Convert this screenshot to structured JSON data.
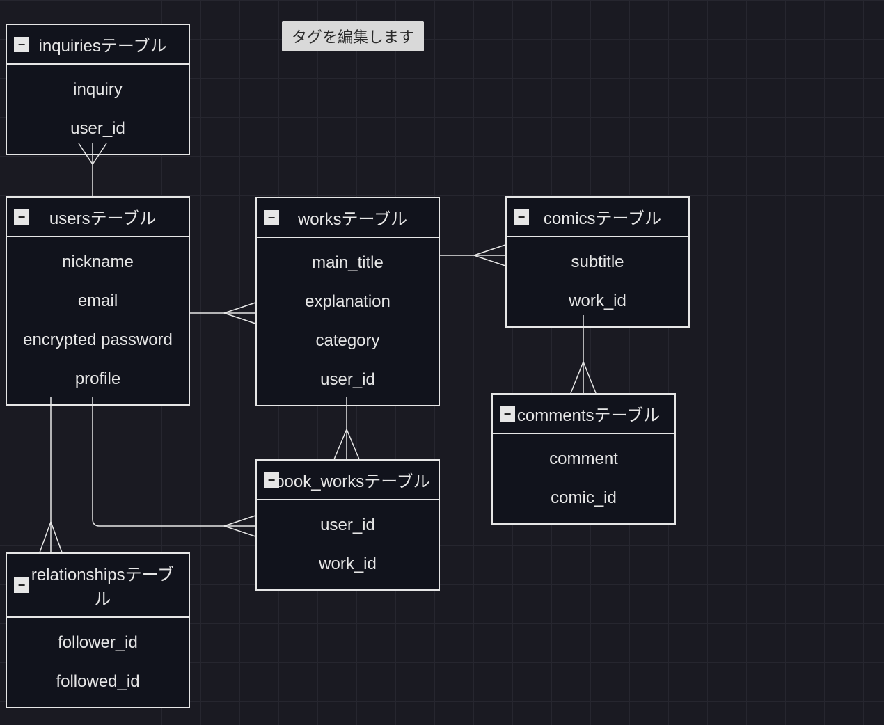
{
  "tag_pill": "タグを編集します",
  "collapse_glyph": "−",
  "entities": {
    "inquiries": {
      "title": "inquiriesテーブル",
      "fields": [
        "inquiry",
        "user_id"
      ]
    },
    "users": {
      "title": "usersテーブル",
      "fields": [
        "nickname",
        "email",
        "encrypted password",
        "profile"
      ]
    },
    "works": {
      "title": "worksテーブル",
      "fields": [
        "main_title",
        "explanation",
        "category",
        "user_id"
      ]
    },
    "comics": {
      "title": "comicsテーブル",
      "fields": [
        "subtitle",
        "work_id"
      ]
    },
    "book_works": {
      "title": "book_worksテーブル",
      "fields": [
        "user_id",
        "work_id"
      ]
    },
    "relationships": {
      "title": "relationshipsテーブル",
      "fields": [
        "follower_id",
        "followed_id"
      ]
    },
    "comments": {
      "title": "commentsテーブル",
      "fields": [
        "comment",
        "comic_id"
      ]
    }
  },
  "relationships_meta": [
    {
      "from": "users",
      "to": "inquiries",
      "type": "one-to-many"
    },
    {
      "from": "users",
      "to": "works",
      "type": "one-to-many"
    },
    {
      "from": "users",
      "to": "relationships",
      "type": "one-to-many"
    },
    {
      "from": "users",
      "to": "book_works",
      "type": "one-to-many"
    },
    {
      "from": "works",
      "to": "comics",
      "type": "one-to-many"
    },
    {
      "from": "works",
      "to": "book_works",
      "type": "one-to-many"
    },
    {
      "from": "comics",
      "to": "comments",
      "type": "one-to-many"
    }
  ]
}
